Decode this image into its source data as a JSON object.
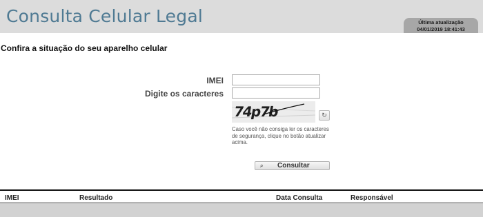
{
  "header": {
    "title": "Consulta Celular Legal",
    "update_label": "Última atualização",
    "update_datetime": "04/01/2019 18:41:43"
  },
  "main": {
    "heading": "Confira a situação do seu aparelho celular"
  },
  "form": {
    "imei_label": "IMEI",
    "imei_value": "",
    "captcha_label": "Digite os caracteres",
    "captcha_value": "",
    "captcha_text": "74p7b",
    "refresh_icon": "refresh-icon",
    "captcha_help": "Caso você não consiga ler os caracteres de segurança, clique no botão atualizar acima.",
    "submit_label": "Consultar",
    "submit_icon": "search-icon"
  },
  "results_table": {
    "columns": [
      "IMEI",
      "Resultado",
      "Data Consulta",
      "Responsável"
    ],
    "rows": []
  },
  "colors": {
    "header_bg": "#dcdcdc",
    "title": "#4f7a93",
    "update_box": "#a7a7a7",
    "table_row_bg": "#d2d2d2"
  }
}
